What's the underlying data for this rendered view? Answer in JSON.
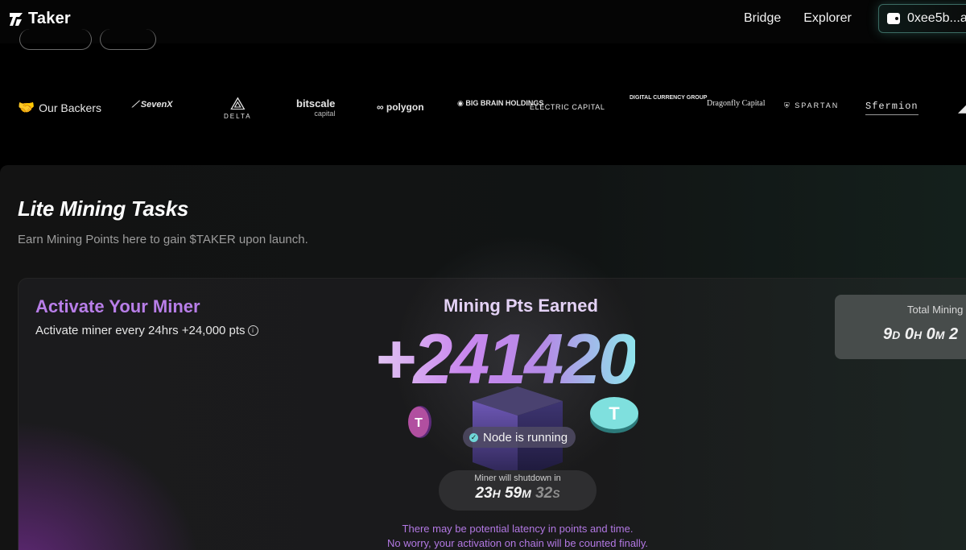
{
  "nav": {
    "brand": "Taker",
    "links": [
      "Bridge",
      "Explorer"
    ],
    "wallet_address": "0xee5b...a"
  },
  "backers": {
    "title": "Our Backers",
    "logos": [
      "SevenX",
      "DELTA",
      "bitscale",
      "capital",
      "polygon",
      "BIG BRAIN HOLDINGS",
      "ELECTRIC CAPITAL",
      "DIGITAL CURRENCY GROUP",
      "Dragonfly Capital",
      "SPARTAN",
      "Sfermion"
    ]
  },
  "section": {
    "title": "Lite Mining Tasks",
    "subtitle": "Earn Mining Points here to gain $TAKER upon launch."
  },
  "miner": {
    "title": "Activate Your Miner",
    "subtitle": "Activate miner every 24hrs +24,000 pts",
    "pts_label": "Mining Pts Earned",
    "pts_value": "+241420",
    "status": "Node is running",
    "shutdown_label": "Miner will shutdown in",
    "shutdown": {
      "h": "23",
      "h_unit": "H",
      "m": "59",
      "m_unit": "M",
      "s": "32",
      "s_unit": "S"
    },
    "latency_line1": "There may be potential latency in points and time.",
    "latency_line2": "No worry, your activation on chain will be counted finally."
  },
  "total": {
    "label": "Total Mining T",
    "d": "9",
    "d_unit": "D",
    "h": "0",
    "h_unit": "H",
    "m": "0",
    "m_unit": "M",
    "partial": "2"
  },
  "colors": {
    "accent_purple": "#b87ee8",
    "accent_teal": "#6fd6d8",
    "background": "#000000"
  }
}
